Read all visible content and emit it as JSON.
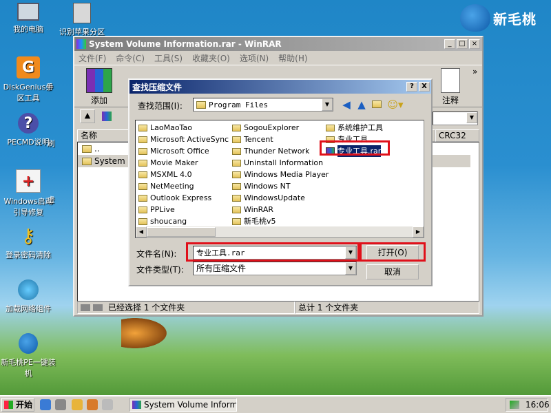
{
  "desktop": {
    "icons": [
      {
        "label": "我的电脑"
      },
      {
        "label": "识别苹果分区"
      },
      {
        "label": "DiskGenius分区工具"
      },
      {
        "label": "PECMD说明"
      },
      {
        "label": "Windows启动引导修复"
      },
      {
        "label": "登录密码清除"
      },
      {
        "label": "加载网络组件"
      },
      {
        "label": "新毛桃PE一键装机"
      },
      {
        "label": "手"
      },
      {
        "label": "刷"
      },
      {
        "label": "虚"
      }
    ],
    "brand": "新毛桃"
  },
  "winrar": {
    "title": "System Volume Information.rar - WinRAR",
    "menu": [
      "文件(F)",
      "命令(C)",
      "工具(S)",
      "收藏夹(O)",
      "选项(N)",
      "帮助(H)"
    ],
    "toolbar": {
      "add_label": "添加",
      "comment_label": "注释",
      "more": "»"
    },
    "columns": {
      "name": "名称",
      "crc": "CRC32"
    },
    "rows": [
      "..",
      "System Vol"
    ],
    "status": {
      "left": "已经选择 1 个文件夹",
      "right": "总计 1 个文件夹"
    }
  },
  "dialog": {
    "title": "查找压缩文件",
    "help_btn": "?",
    "close_btn": "X",
    "lookin_label": "查找范围(I):",
    "lookin_value": "Program Files",
    "folders_col1": [
      "LaoMaoTao",
      "Microsoft ActiveSync",
      "Microsoft Office",
      "Movie Maker",
      "MSXML 4.0",
      "NetMeeting",
      "Outlook Express",
      "PPLive",
      "shoucang"
    ],
    "folders_col2": [
      "SogouExplorer",
      "Tencent",
      "Thunder Network",
      "Uninstall Information",
      "Windows Media Player",
      "Windows NT",
      "WindowsUpdate",
      "WinRAR",
      "新毛桃v5"
    ],
    "folders_col3": [
      "系统维护工具",
      "专业工具"
    ],
    "selected_file": "专业工具.rar",
    "filename_label": "文件名(N):",
    "filename_value": "专业工具.rar",
    "filetype_label": "文件类型(T):",
    "filetype_value": "所有压缩文件",
    "open_btn": "打开(O)",
    "cancel_btn": "取消"
  },
  "taskbar": {
    "start": "开始",
    "task_label": "System Volume Informati...",
    "clock": "16:06"
  },
  "colors": {
    "highlight": "#e0101a",
    "selection": "#0a246a",
    "titlebar_active": "#0a246a"
  }
}
